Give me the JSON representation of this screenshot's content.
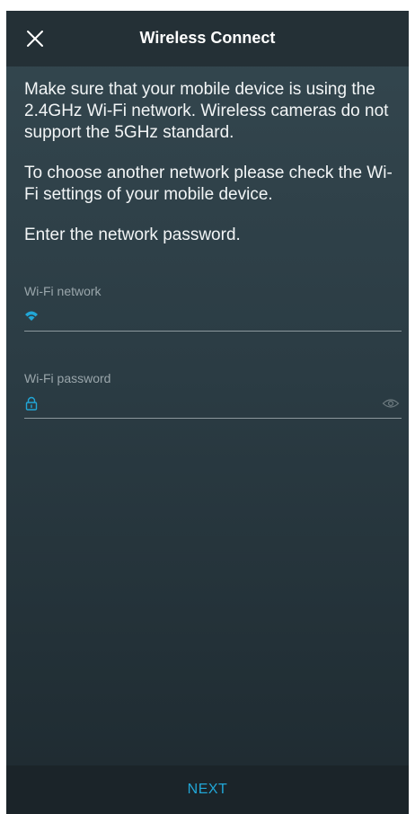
{
  "header": {
    "title": "Wireless Connect",
    "close_icon": "close-icon"
  },
  "content": {
    "paragraph_1": "Make sure that your mobile device is using the 2.4GHz Wi-Fi network. Wireless cameras do not support the 5GHz standard.",
    "paragraph_2": "To choose another network please check the Wi-Fi settings of your mobile device.",
    "paragraph_3": "Enter the network password."
  },
  "wifi_network": {
    "label": "Wi-Fi network",
    "value": "",
    "icon": "wifi-icon"
  },
  "wifi_password": {
    "label": "Wi-Fi password",
    "value": "",
    "icon": "lock-icon",
    "toggle_icon": "eye-icon"
  },
  "footer": {
    "next_label": "NEXT"
  },
  "colors": {
    "accent": "#21a6d6",
    "background": "#2b3c44",
    "header": "#243036"
  }
}
